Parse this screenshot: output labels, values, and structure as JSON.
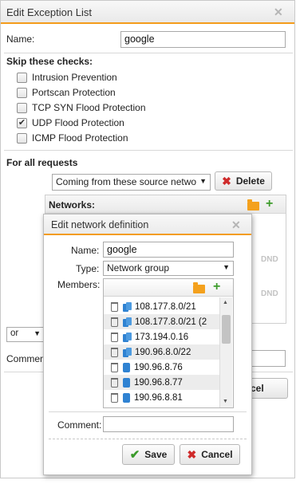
{
  "main_dialog": {
    "title": "Edit Exception List",
    "name_label": "Name:",
    "name_value": "google",
    "skip_heading": "Skip these checks:",
    "checks": [
      {
        "label": "Intrusion Prevention",
        "checked": false
      },
      {
        "label": "Portscan Protection",
        "checked": false
      },
      {
        "label": "TCP SYN Flood Protection",
        "checked": false
      },
      {
        "label": "UDP Flood Protection",
        "checked": true
      },
      {
        "label": "ICMP Flood Protection",
        "checked": false
      }
    ],
    "for_all_heading": "For all requests",
    "condition_select": "Coming from these source netwo",
    "delete_label": "Delete",
    "networks_label": "Networks:",
    "dnd_label": "DND",
    "operator_select": "or",
    "comment_label": "Comment",
    "cancel_label": "Cancel"
  },
  "net_dialog": {
    "title": "Edit network definition",
    "name_label": "Name:",
    "name_value": "google",
    "type_label": "Type:",
    "type_value": "Network group",
    "members_label": "Members:",
    "members": [
      {
        "label": "108.177.8.0/21",
        "kind": "group"
      },
      {
        "label": "108.177.8.0/21 (2",
        "kind": "group"
      },
      {
        "label": "173.194.0.16",
        "kind": "group"
      },
      {
        "label": "190.96.8.0/22",
        "kind": "group"
      },
      {
        "label": "190.96.8.76",
        "kind": "host"
      },
      {
        "label": "190.96.8.77",
        "kind": "host"
      },
      {
        "label": "190.96.8.81",
        "kind": "host"
      }
    ],
    "comment_label": "Comment:",
    "comment_value": "",
    "save_label": "Save",
    "cancel_label": "Cancel"
  },
  "colors": {
    "accent": "#f39c1c",
    "delete": "#cf2b2b",
    "save": "#3a9a2a",
    "network_icon": "#2f82d2"
  }
}
